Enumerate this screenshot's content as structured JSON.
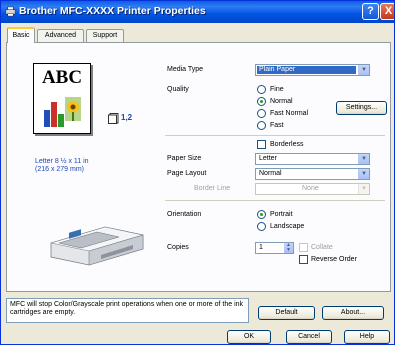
{
  "window": {
    "title": "Brother MFC-XXXX Printer Properties",
    "help_button": "?",
    "close_button": "X"
  },
  "tabs": [
    {
      "label": "Basic"
    },
    {
      "label": "Advanced"
    },
    {
      "label": "Support"
    }
  ],
  "preview": {
    "sample_text": "ABC",
    "pages_per_sheet": "1,2",
    "paper_info_line1": "Letter 8 ½ x 11 in",
    "paper_info_line2": "(216 x 279 mm)"
  },
  "media_type": {
    "label": "Media Type",
    "value": "Plain Paper"
  },
  "quality": {
    "label": "Quality",
    "options": [
      "Fine",
      "Normal",
      "Fast Normal",
      "Fast"
    ],
    "selected": "Normal",
    "settings_button": "Settings..."
  },
  "borderless": {
    "label": "Borderless",
    "checked": false
  },
  "paper_size": {
    "label": "Paper Size",
    "value": "Letter"
  },
  "page_layout": {
    "label": "Page Layout",
    "value": "Normal"
  },
  "border_line": {
    "label": "Border Line",
    "value": "None"
  },
  "orientation": {
    "label": "Orientation",
    "options": [
      "Portrait",
      "Landscape"
    ],
    "selected": "Portrait"
  },
  "copies": {
    "label": "Copies",
    "value": "1",
    "collate_label": "Collate",
    "reverse_order_label": "Reverse Order"
  },
  "message": "MFC will stop Color/Grayscale print operations when one or more of the ink cartridges are empty.",
  "buttons": {
    "default": "Default",
    "about": "About...",
    "ok": "OK",
    "cancel": "Cancel",
    "help": "Help"
  }
}
